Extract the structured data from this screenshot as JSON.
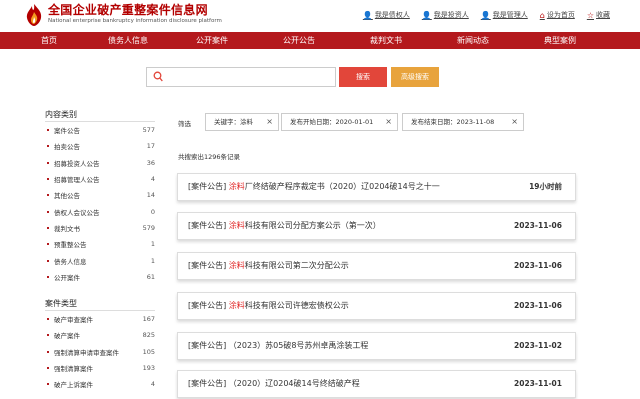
{
  "header": {
    "brand_cn": "全国企业破产重整案件信息网",
    "brand_en": "National enterprise bankruptcy  information disclosure platform",
    "links": [
      {
        "label": "我是债权人",
        "icon": "person-icon"
      },
      {
        "label": "我是投资人",
        "icon": "person-icon"
      },
      {
        "label": "我是管理人",
        "icon": "person-icon"
      },
      {
        "label": "设为首页",
        "icon": "home-icon"
      },
      {
        "label": "收藏",
        "icon": "star-icon"
      }
    ]
  },
  "nav": {
    "items": [
      "首页",
      "债务人信息",
      "公开案件",
      "公开公告",
      "裁判文书",
      "新闻动态",
      "典型案例"
    ]
  },
  "search": {
    "placeholder": "",
    "search_label": "搜索",
    "advanced_label": "高级搜索"
  },
  "sidebar": {
    "sections": [
      {
        "title": "内容类别",
        "items": [
          {
            "label": "案件公告",
            "count": "577"
          },
          {
            "label": "拍卖公告",
            "count": "17"
          },
          {
            "label": "招募投资人公告",
            "count": "36"
          },
          {
            "label": "招募管理人公告",
            "count": "4"
          },
          {
            "label": "其他公告",
            "count": "14"
          },
          {
            "label": "债权人会议公告",
            "count": "0"
          },
          {
            "label": "裁判文书",
            "count": "579"
          },
          {
            "label": "预重整公告",
            "count": "1"
          },
          {
            "label": "债务人信息",
            "count": "1"
          },
          {
            "label": "公开案件",
            "count": "61"
          }
        ]
      },
      {
        "title": "案件类型",
        "items": [
          {
            "label": "破产审查案件",
            "count": "167"
          },
          {
            "label": "破产案件",
            "count": "825"
          },
          {
            "label": "强制清算申请审查案件",
            "count": "105"
          },
          {
            "label": "强制清算案件",
            "count": "193"
          },
          {
            "label": "破产上诉案件",
            "count": "4"
          }
        ]
      }
    ]
  },
  "filter": {
    "label": "筛选",
    "chips": [
      "关键字：涂料",
      "发布开始日期：2020-01-01",
      "发布结束日期：2023-11-08"
    ],
    "close_icon": "close-icon"
  },
  "results": {
    "count_text": "共搜索出1296条记录",
    "items": [
      {
        "prefix": "[案件公告] ",
        "highlight": "涂料",
        "rest": "厂终结破产程序裁定书（2020）辽0204破14号之十一",
        "date": "19小时前"
      },
      {
        "prefix": "[案件公告] ",
        "highlight": "涂料",
        "rest": "科技有限公司分配方案公示（第一次）",
        "date": "2023-11-06"
      },
      {
        "prefix": "[案件公告] ",
        "highlight": "涂料",
        "rest": "科技有限公司第二次分配公示",
        "date": "2023-11-06"
      },
      {
        "prefix": "[案件公告] ",
        "highlight": "涂料",
        "rest": "科技有限公司许德宏债权公示",
        "date": "2023-11-06"
      },
      {
        "prefix": "[案件公告] ",
        "highlight": "",
        "rest": "（2023）苏05破8号苏州卓禹涂装工程",
        "date": "2023-11-02"
      },
      {
        "prefix": "[案件公告] ",
        "highlight": "",
        "rest": "（2020）辽0204破14号终结破产程",
        "date": "2023-11-01"
      }
    ]
  },
  "colors": {
    "nav_bg": "#b4191d",
    "brand": "#b30000",
    "search_btn": "#e2463a",
    "advanced_btn": "#e8a33c",
    "highlight": "#e02020"
  }
}
